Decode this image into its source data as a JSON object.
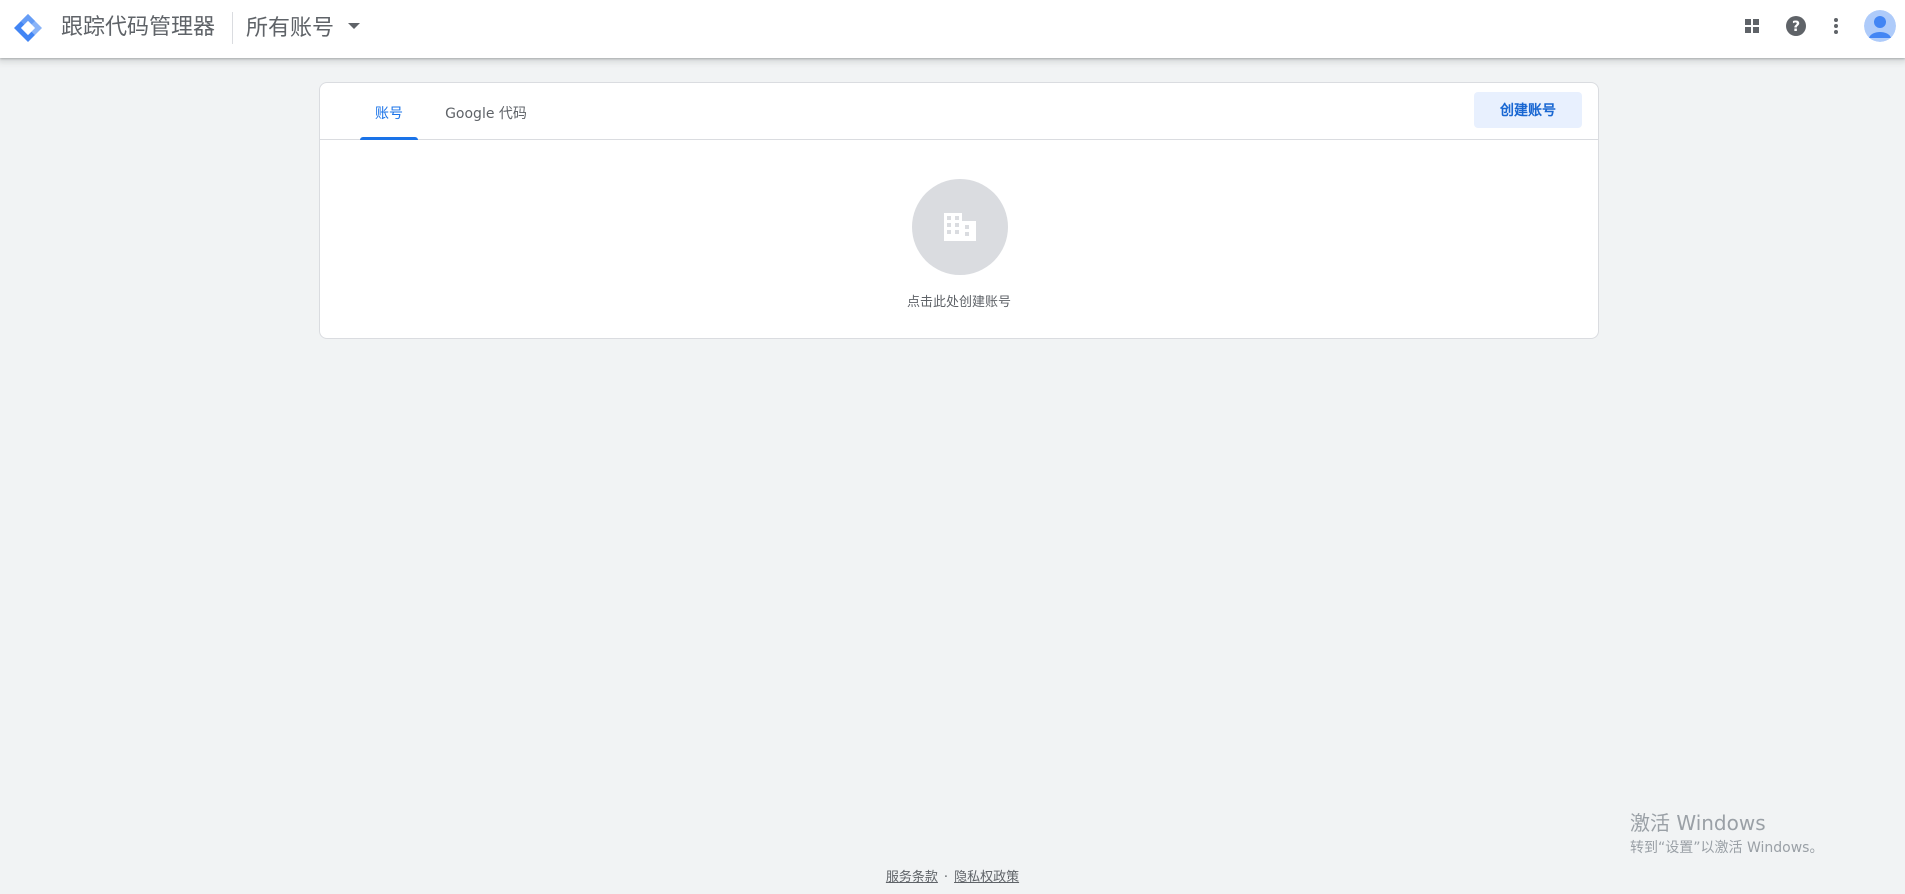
{
  "header": {
    "app_title": "跟踪代码管理器",
    "account_selector": "所有账号"
  },
  "icons": {
    "logo": "tag-manager-logo",
    "apps": "apps-grid-icon",
    "help": "help-icon",
    "more": "more-vert-icon",
    "avatar": "account-avatar"
  },
  "tabs": [
    {
      "label": "账号",
      "active": true
    },
    {
      "label": "Google 代码",
      "active": false
    }
  ],
  "actions": {
    "create_account": "创建账号"
  },
  "empty_state": {
    "icon": "business-building-icon",
    "text": "点击此处创建账号"
  },
  "footer": {
    "terms": "服务条款",
    "separator": "·",
    "privacy": "隐私权政策"
  },
  "watermark": {
    "title": "激活 Windows",
    "subtitle": "转到“设置”以激活 Windows。"
  },
  "colors": {
    "accent": "#1a73e8",
    "background": "#f1f3f4",
    "button_bg": "#e8f0fe"
  }
}
